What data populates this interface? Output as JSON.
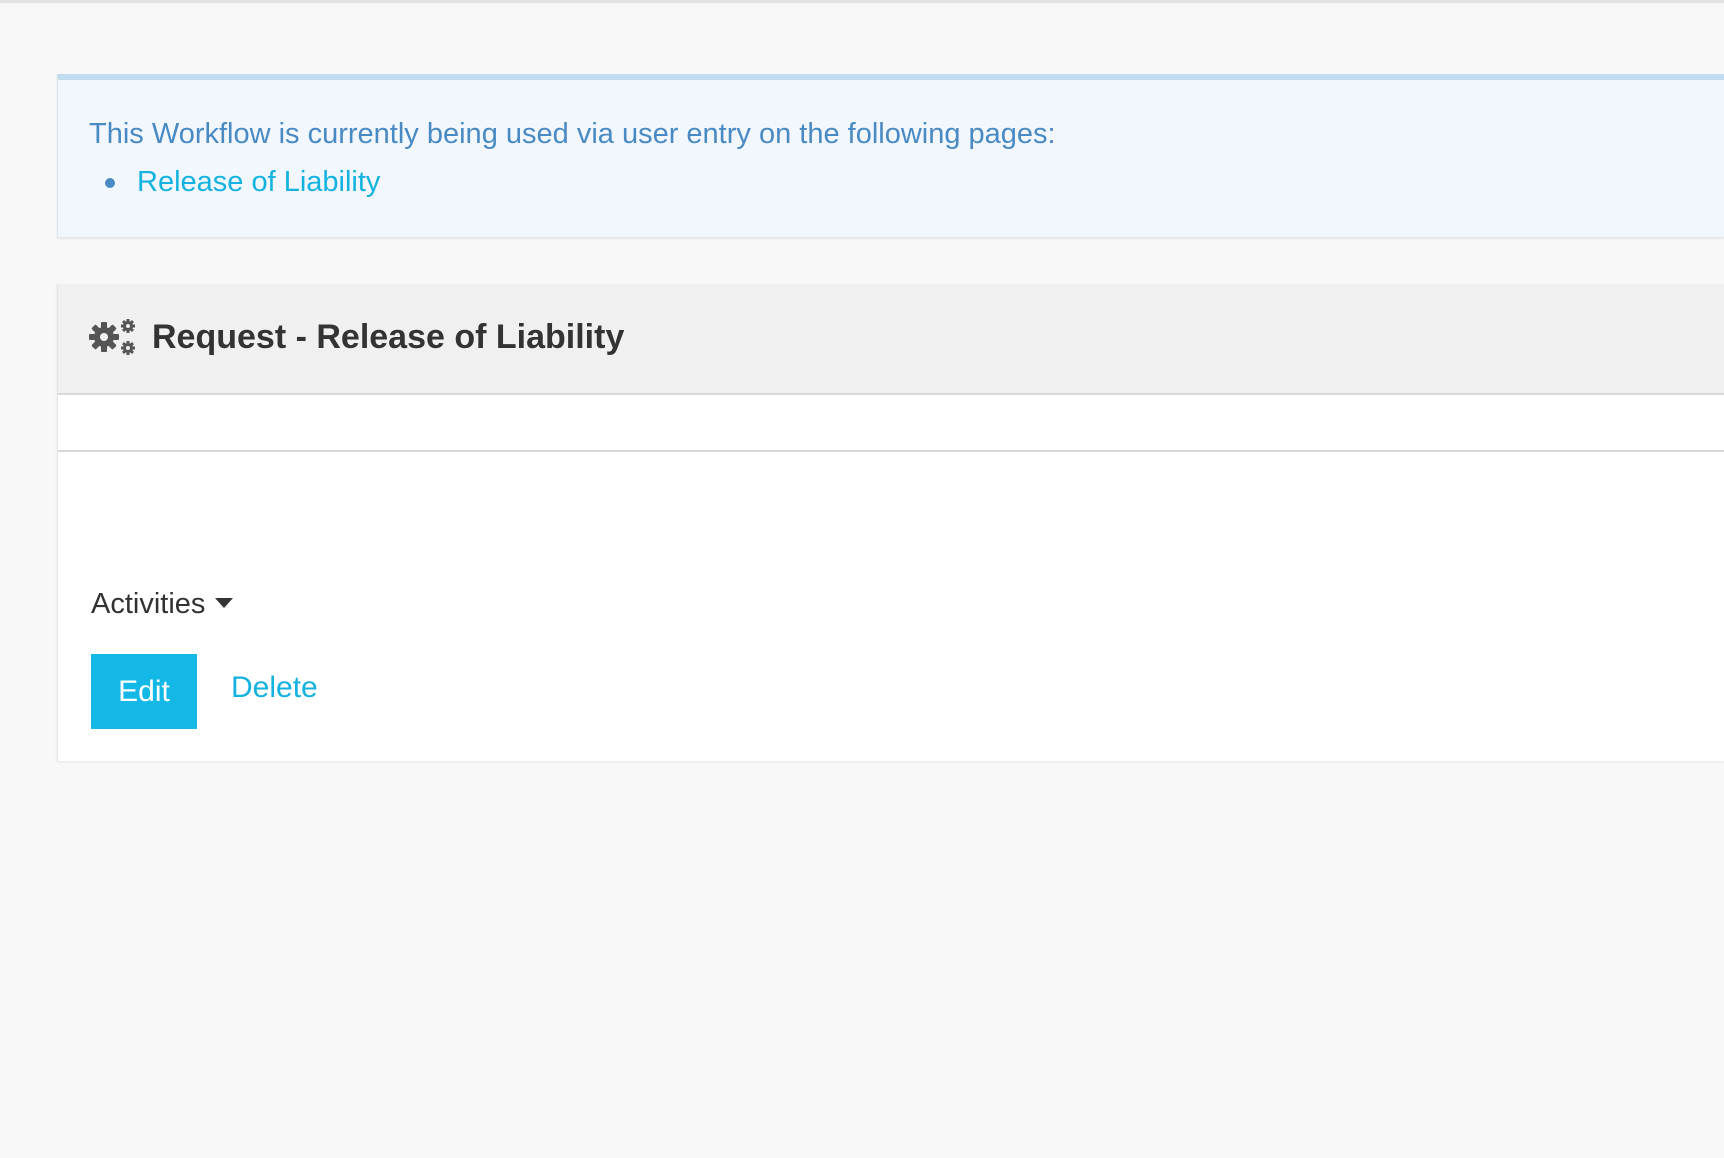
{
  "alert": {
    "message": "This Workflow is currently being used via user entry on the following pages:",
    "pages": [
      {
        "label": "Release of Liability"
      }
    ]
  },
  "panel": {
    "icon": "gears-icon",
    "title": "Request - Release of Liability",
    "activities_label": "Activities",
    "edit_label": "Edit",
    "delete_label": "Delete"
  },
  "colors": {
    "accent": "#14b8e6",
    "info_text": "#4a8ac4",
    "info_background": "#f1f7fc",
    "info_border": "#c2dcef"
  }
}
